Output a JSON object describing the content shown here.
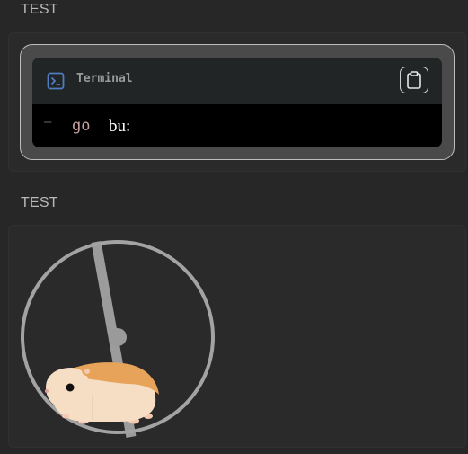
{
  "sections": [
    {
      "label": "TEST"
    },
    {
      "label": "TEST"
    }
  ],
  "terminal": {
    "title": "Terminal",
    "prompt_symbol": "–",
    "command": "go",
    "argument": "bu:",
    "icons": {
      "terminal": "terminal-icon",
      "copy": "clipboard-icon"
    }
  },
  "hamster_wheel": {
    "icon": "hamster-wheel-illustration",
    "colors": {
      "wheel": "#9a9a9a",
      "hamster_fur": "#e8a35a",
      "hamster_belly": "#f7e1c8"
    }
  }
}
